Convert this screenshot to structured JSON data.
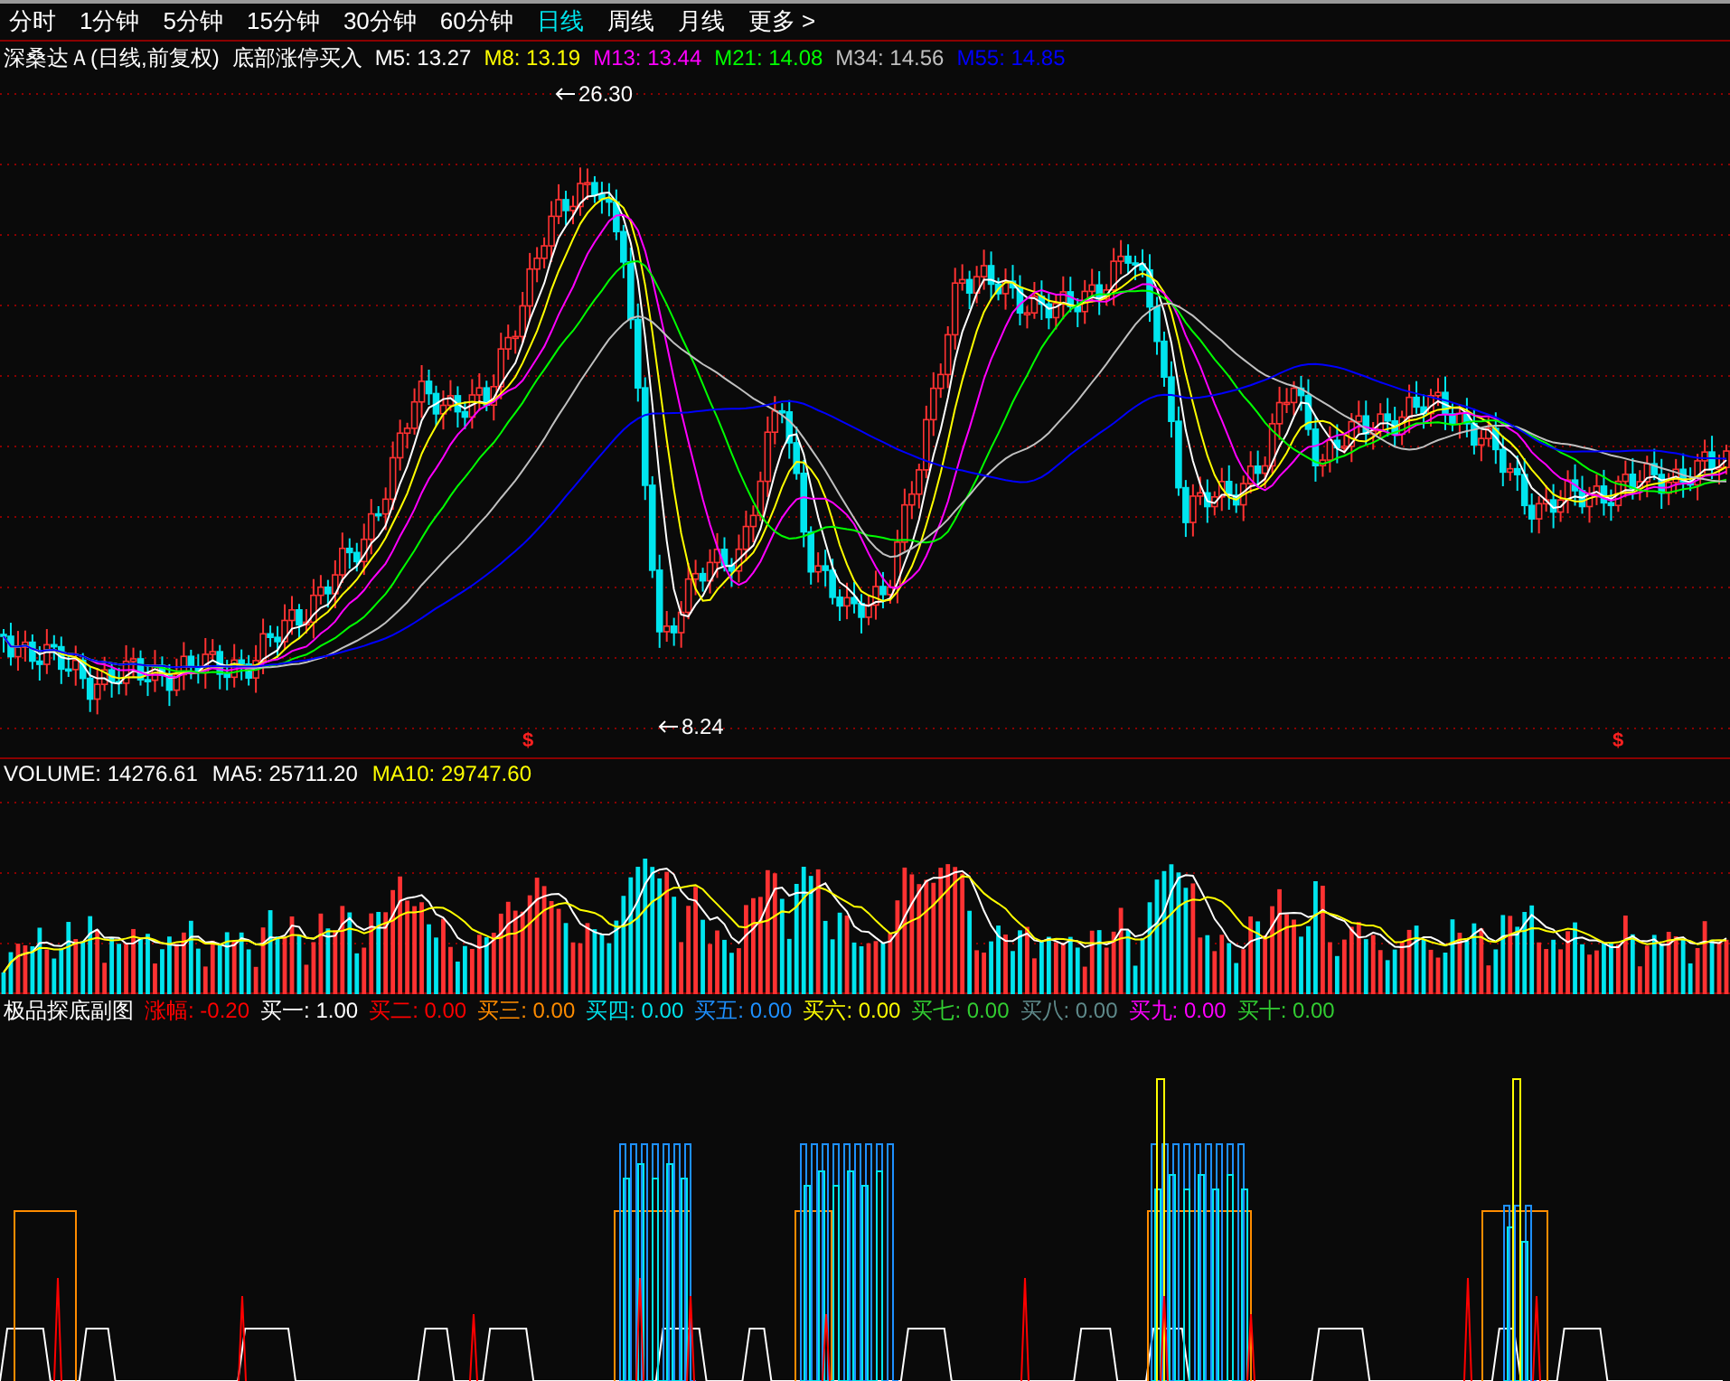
{
  "toolbar": {
    "periods": [
      {
        "label": "分时",
        "selected": false
      },
      {
        "label": "1分钟",
        "selected": false
      },
      {
        "label": "5分钟",
        "selected": false
      },
      {
        "label": "15分钟",
        "selected": false
      },
      {
        "label": "30分钟",
        "selected": false
      },
      {
        "label": "60分钟",
        "selected": false
      },
      {
        "label": "日线",
        "selected": true
      },
      {
        "label": "周线",
        "selected": false
      },
      {
        "label": "月线",
        "selected": false
      },
      {
        "label": "更多 >",
        "selected": false
      }
    ]
  },
  "price_panel": {
    "title": "深桑达Ａ(日线,前复权)",
    "indicator_name": "底部涨停买入",
    "legend": [
      {
        "label": "M5:",
        "value": "13.27",
        "color": "#ffffff"
      },
      {
        "label": "M8:",
        "value": "13.19",
        "color": "#ffff00"
      },
      {
        "label": "M13:",
        "value": "13.44",
        "color": "#ff00ff"
      },
      {
        "label": "M21:",
        "value": "14.08",
        "color": "#00ff00"
      },
      {
        "label": "M34:",
        "value": "14.56",
        "color": "#c0c0c0"
      },
      {
        "label": "M55:",
        "value": "14.85",
        "color": "#0000ff"
      }
    ],
    "high_label": "26.30",
    "low_label": "8.24",
    "signal_markers": [
      "$",
      "$"
    ]
  },
  "volume_panel": {
    "legend": [
      {
        "label": "VOLUME:",
        "value": "14276.61",
        "color": "#ffffff"
      },
      {
        "label": "MA5:",
        "value": "25711.20",
        "color": "#ffffff"
      },
      {
        "label": "MA10:",
        "value": "29747.60",
        "color": "#ffff00"
      }
    ]
  },
  "indicator_panel": {
    "title": "极品探底副图",
    "legend": [
      {
        "label": "涨幅:",
        "value": "-0.20",
        "color": "#ff0000"
      },
      {
        "label": "买一:",
        "value": "1.00",
        "color": "#ffffff"
      },
      {
        "label": "买二:",
        "value": "0.00",
        "color": "#ff0000"
      },
      {
        "label": "买三:",
        "value": "0.00",
        "color": "#ff8c00"
      },
      {
        "label": "买四:",
        "value": "0.00",
        "color": "#00e5ee"
      },
      {
        "label": "买五:",
        "value": "0.00",
        "color": "#1e90ff"
      },
      {
        "label": "买六:",
        "value": "0.00",
        "color": "#ffff00"
      },
      {
        "label": "买七:",
        "value": "0.00",
        "color": "#32cd32"
      },
      {
        "label": "买八:",
        "value": "0.00",
        "color": "#5f8a8b"
      },
      {
        "label": "买九:",
        "value": "0.00",
        "color": "#ff00ff"
      },
      {
        "label": "买十:",
        "value": "0.00",
        "color": "#32cd32"
      }
    ]
  }
}
